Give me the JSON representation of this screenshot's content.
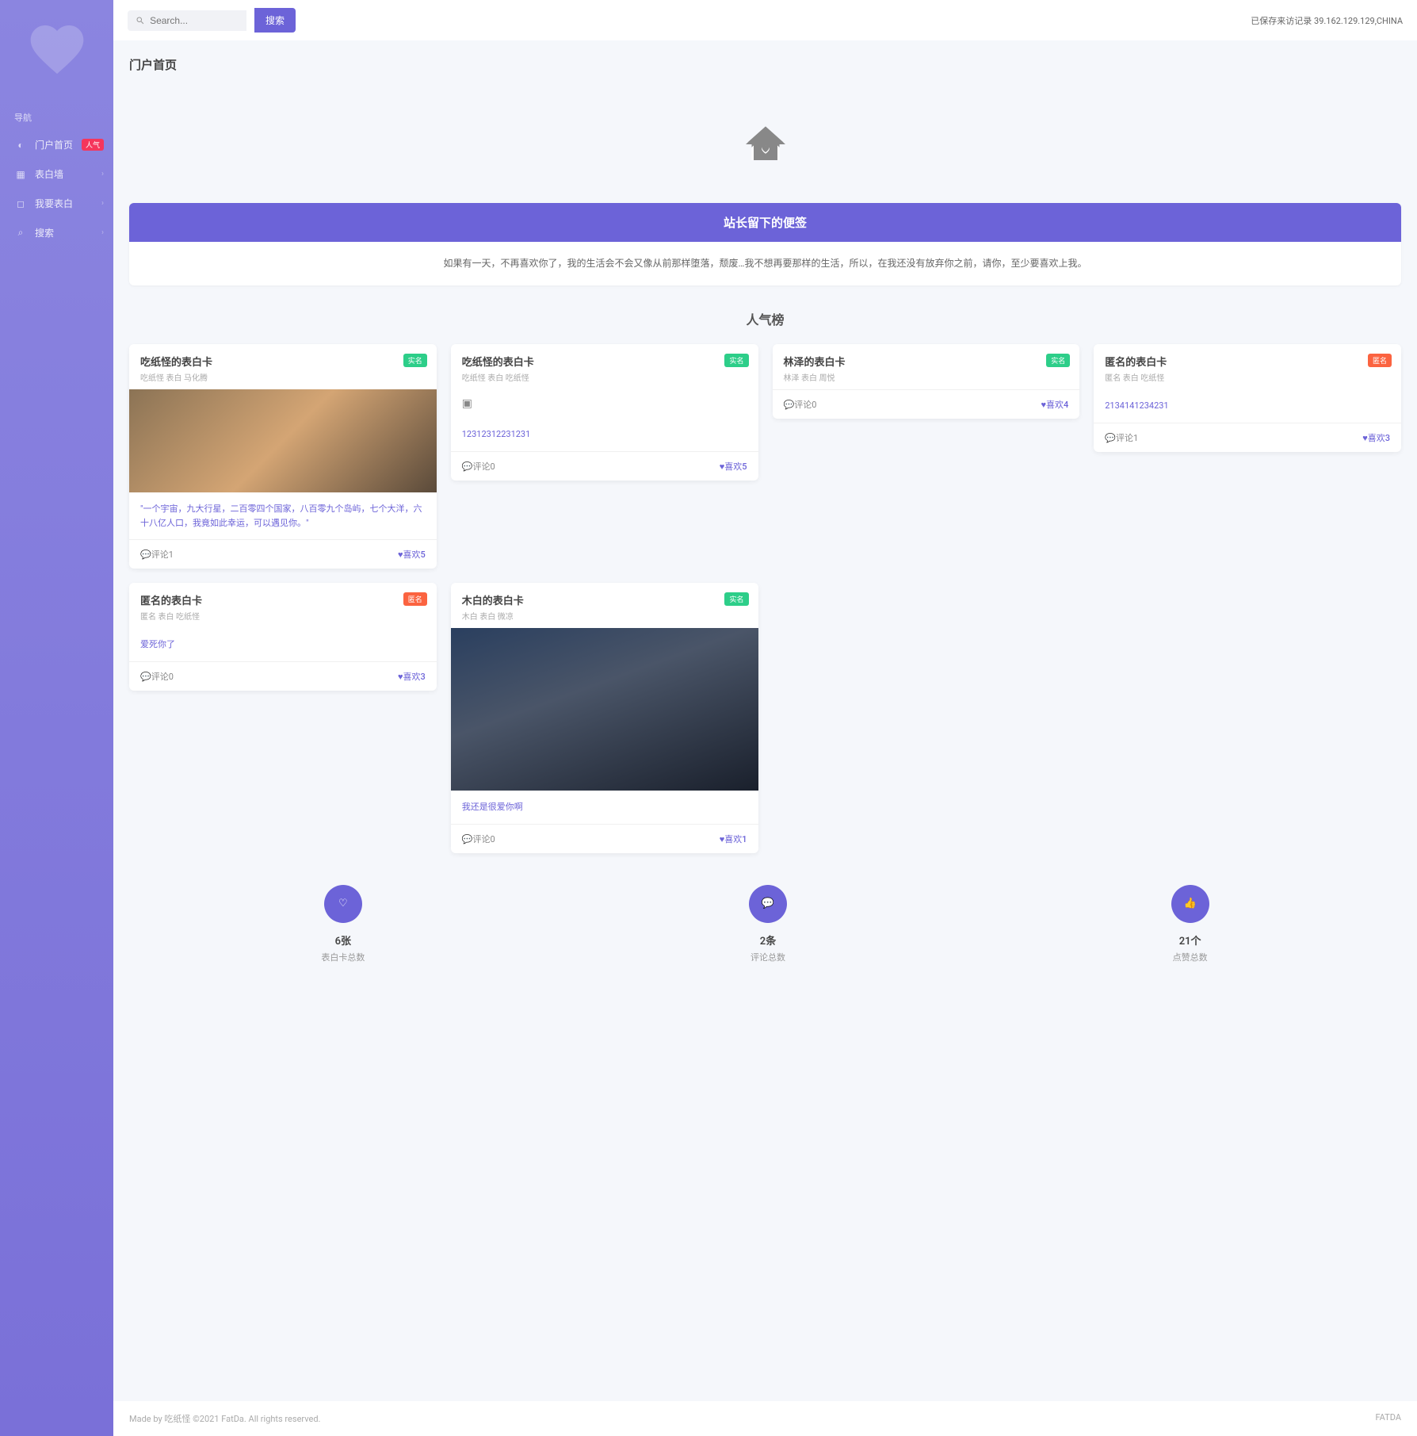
{
  "topbar": {
    "search_placeholder": "Search...",
    "search_btn": "搜索",
    "visit_info": "已保存来访记录 39.162.129.129,CHINA"
  },
  "sidebar": {
    "nav_title": "导航",
    "items": [
      {
        "label": "门户首页",
        "badge": "人气"
      },
      {
        "label": "表白墙"
      },
      {
        "label": "我要表白"
      },
      {
        "label": "搜索"
      }
    ]
  },
  "page": {
    "title": "门户首页",
    "note_header": "站长留下的便签",
    "note_body": "如果有一天，不再喜欢你了，我的生活会不会又像从前那样堕落，颓废…我不想再要那样的生活，所以，在我还没有放弃你之前，请你，至少要喜欢上我。",
    "rank_title": "人气榜"
  },
  "cards": [
    {
      "title": "吃纸怪的表白卡",
      "sub": "吃纸怪 表白 马化腾",
      "tag": "实名",
      "tag_cls": "tag-real",
      "img": "img1",
      "text": "\"一个宇宙，九大行星，二百零四个国家，八百零九个岛屿，七个大洋，六十八亿人口，我竟如此幸运，可以遇见你。\"",
      "comments": "评论1",
      "likes": "喜欢5"
    },
    {
      "title": "吃纸怪的表白卡",
      "sub": "吃纸怪 表白 吃纸怪",
      "tag": "实名",
      "tag_cls": "tag-real",
      "broken": true,
      "text": "12312312231231",
      "comments": "评论0",
      "likes": "喜欢5"
    },
    {
      "title": "林泽的表白卡",
      "sub": "林泽 表白 周悦",
      "tag": "实名",
      "tag_cls": "tag-real",
      "comments": "评论0",
      "likes": "喜欢4"
    },
    {
      "title": "匿名的表白卡",
      "sub": "匿名 表白 吃纸怪",
      "tag": "匿名",
      "tag_cls": "tag-anon",
      "text": "2134141234231",
      "comments": "评论1",
      "likes": "喜欢3"
    },
    {
      "title": "匿名的表白卡",
      "sub": "匿名 表白 吃纸怪",
      "tag": "匿名",
      "tag_cls": "tag-anon",
      "text": "爱死你了",
      "comments": "评论0",
      "likes": "喜欢3"
    },
    {
      "title": "木白的表白卡",
      "sub": "木白 表白 微凉",
      "tag": "实名",
      "tag_cls": "tag-real",
      "img": "img2",
      "text": "我还是很爱你啊",
      "comments": "评论0",
      "likes": "喜欢1"
    }
  ],
  "stats": [
    {
      "num": "6张",
      "label": "表白卡总数"
    },
    {
      "num": "2条",
      "label": "评论总数"
    },
    {
      "num": "21个",
      "label": "点赞总数"
    }
  ],
  "footer": {
    "left": "Made by 吃纸怪 ©2021 FatDa. All rights reserved.",
    "right": "FATDA"
  }
}
